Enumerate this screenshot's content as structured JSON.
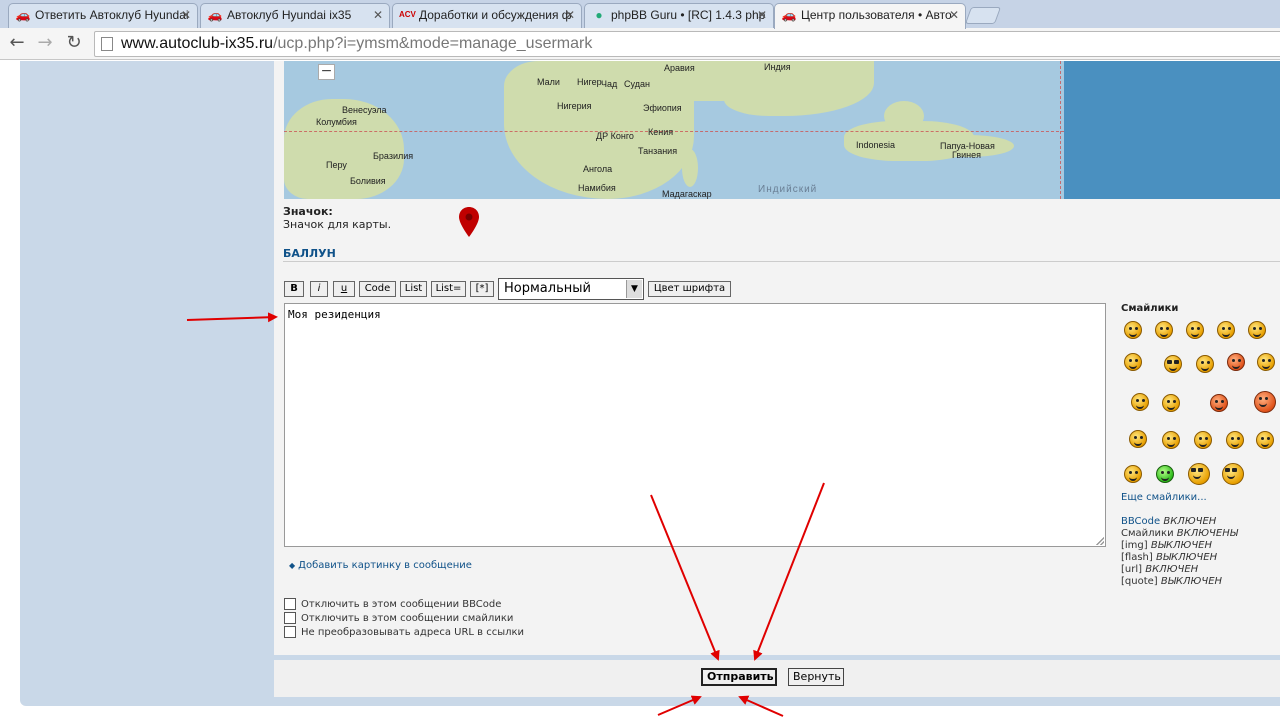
{
  "browser": {
    "tabs": [
      {
        "label": "Ответить Автоклуб Hyundai",
        "icon": "car-icon",
        "active": false
      },
      {
        "label": "Автоклуб Hyundai ix35",
        "icon": "car-icon",
        "active": false
      },
      {
        "label": "Доработки и обсуждения ф",
        "icon": "acv-club-icon",
        "active": false
      },
      {
        "label": "phpBB Guru • [RC] 1.4.3 php",
        "icon": "phpbb-icon",
        "active": false
      },
      {
        "label": "Центр пользователя • Авто",
        "icon": "car-icon",
        "active": true
      }
    ],
    "url_host": "www.autoclub-ix35.ru",
    "url_path": "/ucp.php?i=ymsm&mode=manage_usermark"
  },
  "map": {
    "labels": {
      "arabia": "Аравия",
      "india": "Индия",
      "mali": "Мали",
      "niger": "Нигер",
      "chad": "Чад",
      "sudan": "Судан",
      "venezuela": "Венесуэла",
      "colombia": "Колумбия",
      "nigeria": "Нигерия",
      "ethiopia": "Эфиопия",
      "drc": "ДР Конго",
      "kenya": "Кения",
      "tanzania": "Танзания",
      "brazil": "Бразилия",
      "peru": "Перу",
      "bolivia": "Боливия",
      "angola": "Ангола",
      "namibia": "Намибия",
      "madagascar": "Мадагаскар",
      "indonesia": "Indonesia",
      "png_line1": "Папуа-Новая",
      "png_line2": "Гвинея",
      "indian_ocean": "Индийский"
    },
    "zoom_out": "−"
  },
  "icon_field": {
    "title": "Значок:",
    "desc": "Значок для карты."
  },
  "balloon": {
    "section_title": "БАЛЛУН",
    "bbcode_buttons": [
      "B",
      "i",
      "u",
      "Code",
      "List",
      "List=",
      "[*]"
    ],
    "font_size_selected": "Нормальный",
    "font_color_button": "Цвет шрифта",
    "message_text": "Моя резиденция",
    "add_image_link": "Добавить картинку в сообщение"
  },
  "smilies": {
    "title": "Смайлики",
    "more_link": "Еще смайлики..."
  },
  "bbcode_status": [
    {
      "key": "BBCode",
      "value": "ВКЛЮЧЕН"
    },
    {
      "key": "Смайлики",
      "value": "ВКЛЮЧЕНЫ"
    },
    {
      "key": "[img]",
      "value": "ВЫКЛЮЧЕН"
    },
    {
      "key": "[flash]",
      "value": "ВЫКЛЮЧЕН"
    },
    {
      "key": "[url]",
      "value": "ВКЛЮЧЕН"
    },
    {
      "key": "[quote]",
      "value": "ВЫКЛЮЧЕН"
    }
  ],
  "options": [
    {
      "label": "Отключить в этом сообщении BBCode",
      "checked": false
    },
    {
      "label": "Отключить в этом сообщении смайлики",
      "checked": false
    },
    {
      "label": "Не преобразовывать адреса URL в ссылки",
      "checked": false
    }
  ],
  "actions": {
    "submit": "Отправить",
    "reset": "Вернуть"
  },
  "colors": {
    "link": "#105289",
    "annotation_arrow": "#e00000",
    "pin": "#c00000"
  }
}
